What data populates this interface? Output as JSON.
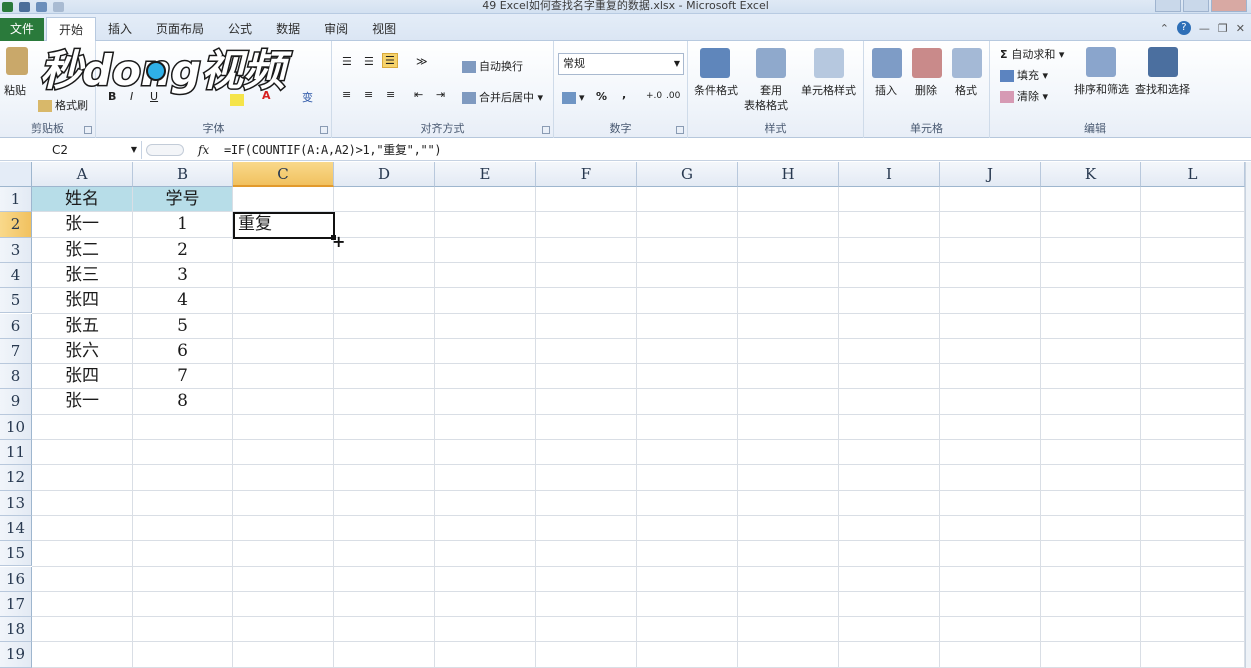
{
  "window": {
    "title": "49 Excel如何查找名字重复的数据.xlsx - Microsoft Excel"
  },
  "tabs": {
    "file": "文件",
    "items": [
      "开始",
      "插入",
      "页面布局",
      "公式",
      "数据",
      "审阅",
      "视图"
    ],
    "active": "开始"
  },
  "ribbon": {
    "clipboard": {
      "paste": "粘贴",
      "format_painter": "格式刷",
      "label": "剪贴板"
    },
    "font": {
      "label": "字体",
      "bold": "B",
      "italic": "I",
      "underline": "U",
      "color": "A",
      "phonetic": "变"
    },
    "alignment": {
      "wrap": "自动换行",
      "merge": "合并后居中",
      "label": "对齐方式"
    },
    "number": {
      "format": "常规",
      "percent": "%",
      "comma": ",",
      "label": "数字"
    },
    "styles": {
      "conditional": "条件格式",
      "table_line1": "套用",
      "table_line2": "表格格式",
      "cell_styles": "单元格样式",
      "label": "样式"
    },
    "cells": {
      "insert": "插入",
      "delete": "删除",
      "format": "格式",
      "label": "单元格"
    },
    "editing": {
      "autosum": "自动求和",
      "fill": "填充",
      "clear": "清除",
      "sort": "排序和筛选",
      "find": "查找和选择",
      "label": "编辑"
    }
  },
  "watermark": {
    "text": "秒dong视频"
  },
  "formula_bar": {
    "name_box": "C2",
    "fx": "fx",
    "formula": "=IF(COUNTIF(A:A,A2)>1,\"重复\",\"\")"
  },
  "sheet": {
    "columns": [
      "A",
      "B",
      "C",
      "D",
      "E",
      "F",
      "G",
      "H",
      "I",
      "J",
      "K",
      "L"
    ],
    "rows": [
      "1",
      "2",
      "3",
      "4",
      "5",
      "6",
      "7",
      "8",
      "9",
      "10",
      "11",
      "12",
      "13",
      "14",
      "15",
      "16",
      "17",
      "18",
      "19"
    ],
    "header": {
      "a": "姓名",
      "b": "学号"
    },
    "names": [
      "张一",
      "张二",
      "张三",
      "张四",
      "张五",
      "张六",
      "张四",
      "张一"
    ],
    "ids": [
      "1",
      "2",
      "3",
      "4",
      "5",
      "6",
      "7",
      "8"
    ],
    "c2": "重复",
    "selected_cell": "C2"
  },
  "colors": {
    "header_fill": "#b7dde8",
    "file_tab": "#2a7a3b",
    "selected_header": "#f1c15f"
  }
}
